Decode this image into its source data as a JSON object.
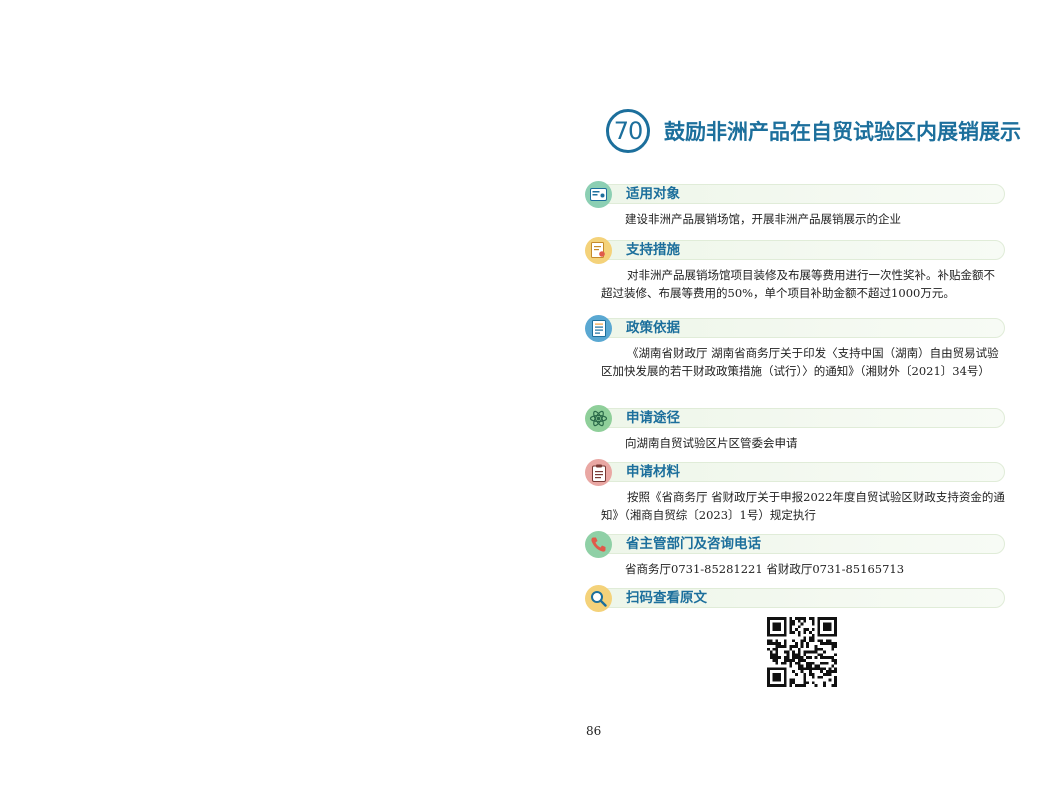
{
  "item_number": "70",
  "title": "鼓励非洲产品在自贸试验区内展销展示",
  "sections": [
    {
      "heading": "适用对象",
      "icon": "id-card-icon",
      "color": "#8ccfb3",
      "body": "建设非洲产品展销场馆，开展非洲产品展销展示的企业"
    },
    {
      "heading": "支持措施",
      "icon": "certificate-icon",
      "color": "#f4d27a",
      "body": "对非洲产品展销场馆项目装修及布展等费用进行一次性奖补。补贴金额不超过装修、布展等费用的50%，单个项目补助金额不超过1000万元。"
    },
    {
      "heading": "政策依据",
      "icon": "document-icon",
      "color": "#5aa8d2",
      "body": "《湖南省财政厅 湖南省商务厅关于印发〈支持中国（湖南）自由贸易试验区加快发展的若干财政政策措施（试行）〉的通知》（湘财外〔2021〕34号）"
    },
    {
      "heading": "申请途径",
      "icon": "atom-icon",
      "color": "#8fcf9a",
      "body": "向湖南自贸试验区片区管委会申请"
    },
    {
      "heading": "申请材料",
      "icon": "clipboard-icon",
      "color": "#e9a7a3",
      "body": "按照《省商务厅 省财政厅关于申报2022年度自贸试验区财政支持资金的通知》（湘商自贸综〔2023〕1号）规定执行"
    },
    {
      "heading": "省主管部门及咨询电话",
      "icon": "phone-icon",
      "color": "#8fd0a6",
      "body": "省商务厅0731-85281221  省财政厅0731-85165713"
    },
    {
      "heading": "扫码查看原文",
      "icon": "search-icon",
      "color": "#f4d27a",
      "body": ""
    }
  ],
  "page_number": "86"
}
